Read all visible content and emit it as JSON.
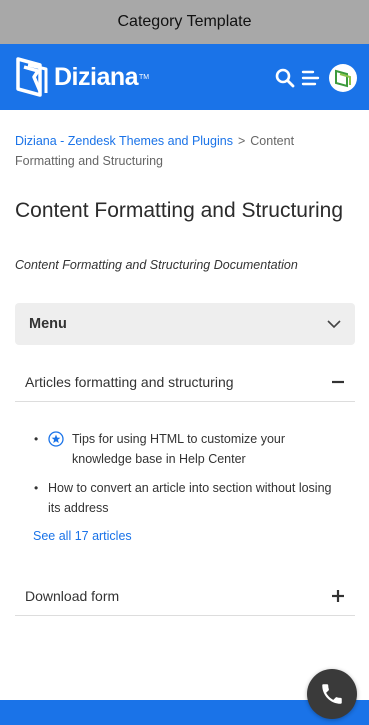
{
  "window": {
    "title": "Category Template"
  },
  "header": {
    "logo_text": "Diziana",
    "logo_tm": "TM",
    "icons": [
      "search-icon",
      "list-icon",
      "user-avatar"
    ],
    "brand_color": "#1a73e8"
  },
  "breadcrumb": {
    "home": "Diziana - Zendesk Themes and Plugins",
    "separator": ">",
    "current": "Content Formatting and Structuring"
  },
  "page": {
    "title": "Content Formatting and Structuring",
    "description": "Content Formatting and Structuring Documentation"
  },
  "menu": {
    "label": "Menu",
    "icon": "chevron-down-icon"
  },
  "sections": [
    {
      "title": "Articles formatting and structuring",
      "icon": "minus-icon",
      "articles": [
        {
          "title": "Tips for using HTML to customize your knowledge base in Help Center",
          "promoted": true
        },
        {
          "title": "How to convert an article into section without losing its address",
          "promoted": false
        }
      ],
      "see_all": "See all 17 articles"
    },
    {
      "title": "Download form",
      "icon": "plus-icon"
    }
  ],
  "contact": {
    "icon": "phone-icon"
  }
}
